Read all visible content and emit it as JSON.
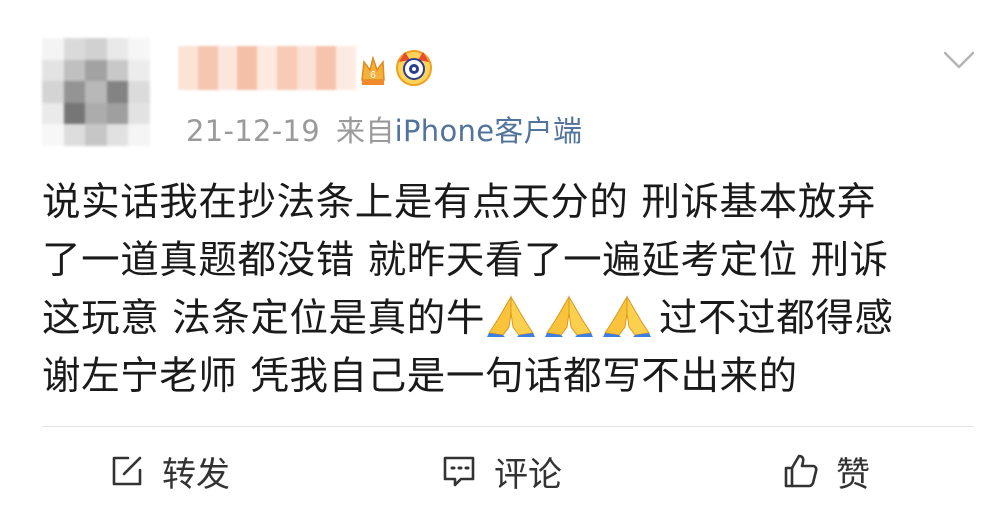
{
  "post": {
    "timestamp": "21-12-19",
    "source_prefix": "来自",
    "source": "iPhone客户端",
    "lines": [
      "说实话我在抄法条上是有点天分的 刑诉基本放弃",
      "了一道真题都没错 就昨天看了一遍延考定位 刑诉",
      "这玩意 法条定位是真的牛",
      "过不过都得感",
      "谢左宁老师 凭我自己是一句话都写不出来的"
    ],
    "emoji": "folded-hands-icon"
  },
  "actions": {
    "repost_label": "转发",
    "comment_label": "评论",
    "like_label": "赞"
  },
  "colors": {
    "text": "#1a1a1a",
    "meta": "#9a9a9a",
    "source_link": "#52739b",
    "divider": "#e4e4e4"
  }
}
